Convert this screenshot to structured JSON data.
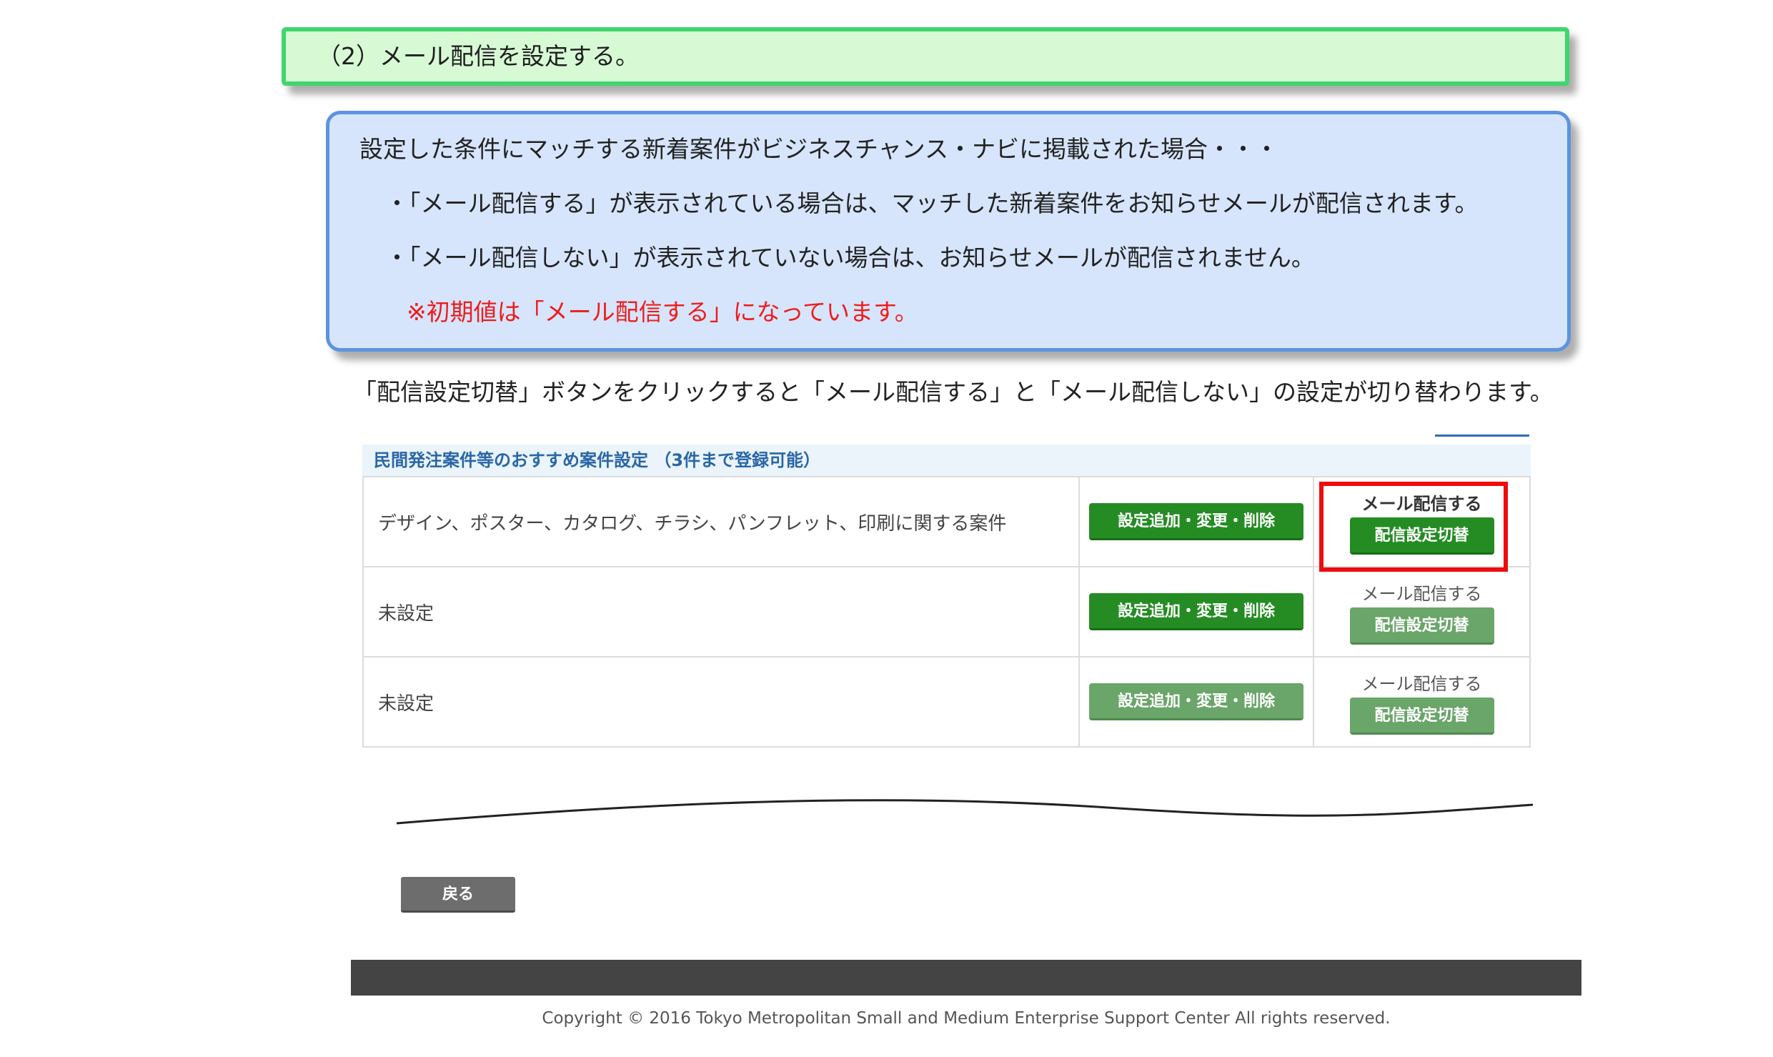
{
  "heading": {
    "text": "（2）メール配信を設定する。"
  },
  "info_box": {
    "line1": "設定した条件にマッチする新着案件がビジネスチャンス・ナビに掲載された場合・・・",
    "line2": "・「メール配信する」が表示されている場合は、マッチした新着案件をお知らせメールが配信されます。",
    "line3": "・「メール配信しない」が表示されていない場合は、お知らせメールが配信されません。",
    "note": "※初期値は「メール配信する」になっています。"
  },
  "instruction": "「配信設定切替」ボタンをクリックすると「メール配信する」と「メール配信しない」の設定が切り替わります。",
  "panel": {
    "title": "民間発注案件等のおすすめ案件設定 （3件まで登録可能）",
    "rows": [
      {
        "condition": "デザイン、ポスター、カタログ、チラシ、パンフレット、印刷に関する案件",
        "edit_button": "設定追加・変更・削除",
        "status": "メール配信する",
        "toggle_button": "配信設定切替"
      },
      {
        "condition": "未設定",
        "edit_button": "設定追加・変更・削除",
        "status": "メール配信する",
        "toggle_button": "配信設定切替"
      },
      {
        "condition": "未設定",
        "edit_button": "設定追加・変更・削除",
        "status": "メール配信する",
        "toggle_button": "配信設定切替"
      }
    ]
  },
  "back_button": "戻る",
  "footer": {
    "copyright": "Copyright © 2016 Tokyo Metropolitan Small and Medium Enterprise Support Center All rights reserved."
  },
  "colors": {
    "button_active": "#248c23",
    "button_inactive": "#6aa56a",
    "highlight_frame": "#ee0c0c",
    "note_text": "#ee1c1c"
  }
}
